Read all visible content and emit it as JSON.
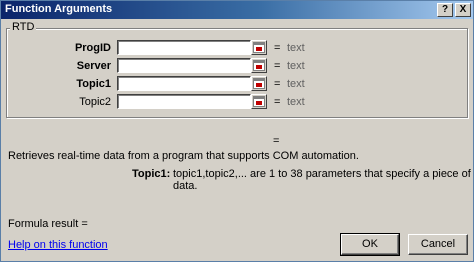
{
  "window": {
    "title": "Function Arguments",
    "help_glyph": "?",
    "close_glyph": "X"
  },
  "function_group": {
    "label": "RTD",
    "arguments": [
      {
        "label": "ProgID",
        "bold": true,
        "value": "",
        "eq": "=",
        "type": "text"
      },
      {
        "label": "Server",
        "bold": true,
        "value": "",
        "eq": "=",
        "type": "text"
      },
      {
        "label": "Topic1",
        "bold": true,
        "value": "",
        "eq": "=",
        "type": "text"
      },
      {
        "label": "Topic2",
        "bold": false,
        "value": "",
        "eq": "=",
        "type": "text"
      }
    ]
  },
  "result_eq": "=",
  "description": "Retrieves real-time data from a program that supports COM automation.",
  "arg_help": {
    "name": "Topic1:",
    "text": "topic1,topic2,... are 1 to 38 parameters that specify a piece of data."
  },
  "formula_result": {
    "label": "Formula result =",
    "value": ""
  },
  "help_link": "Help on this function",
  "buttons": {
    "ok": "OK",
    "cancel": "Cancel"
  },
  "icons": {
    "range_selector": "collapse-dialog-icon"
  }
}
